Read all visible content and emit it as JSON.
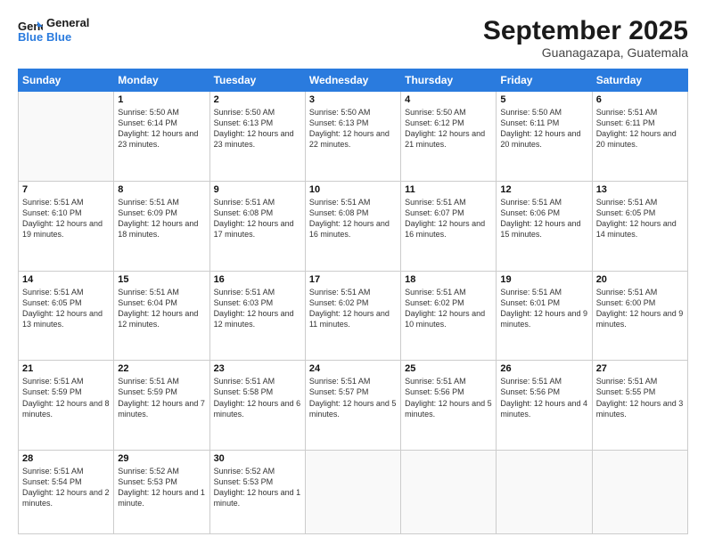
{
  "header": {
    "logo_line1": "General",
    "logo_line2": "Blue",
    "month": "September 2025",
    "location": "Guanagazapa, Guatemala"
  },
  "weekdays": [
    "Sunday",
    "Monday",
    "Tuesday",
    "Wednesday",
    "Thursday",
    "Friday",
    "Saturday"
  ],
  "weeks": [
    [
      {
        "day": "",
        "info": ""
      },
      {
        "day": "1",
        "info": "Sunrise: 5:50 AM\nSunset: 6:14 PM\nDaylight: 12 hours\nand 23 minutes."
      },
      {
        "day": "2",
        "info": "Sunrise: 5:50 AM\nSunset: 6:13 PM\nDaylight: 12 hours\nand 23 minutes."
      },
      {
        "day": "3",
        "info": "Sunrise: 5:50 AM\nSunset: 6:13 PM\nDaylight: 12 hours\nand 22 minutes."
      },
      {
        "day": "4",
        "info": "Sunrise: 5:50 AM\nSunset: 6:12 PM\nDaylight: 12 hours\nand 21 minutes."
      },
      {
        "day": "5",
        "info": "Sunrise: 5:50 AM\nSunset: 6:11 PM\nDaylight: 12 hours\nand 20 minutes."
      },
      {
        "day": "6",
        "info": "Sunrise: 5:51 AM\nSunset: 6:11 PM\nDaylight: 12 hours\nand 20 minutes."
      }
    ],
    [
      {
        "day": "7",
        "info": "Sunrise: 5:51 AM\nSunset: 6:10 PM\nDaylight: 12 hours\nand 19 minutes."
      },
      {
        "day": "8",
        "info": "Sunrise: 5:51 AM\nSunset: 6:09 PM\nDaylight: 12 hours\nand 18 minutes."
      },
      {
        "day": "9",
        "info": "Sunrise: 5:51 AM\nSunset: 6:08 PM\nDaylight: 12 hours\nand 17 minutes."
      },
      {
        "day": "10",
        "info": "Sunrise: 5:51 AM\nSunset: 6:08 PM\nDaylight: 12 hours\nand 16 minutes."
      },
      {
        "day": "11",
        "info": "Sunrise: 5:51 AM\nSunset: 6:07 PM\nDaylight: 12 hours\nand 16 minutes."
      },
      {
        "day": "12",
        "info": "Sunrise: 5:51 AM\nSunset: 6:06 PM\nDaylight: 12 hours\nand 15 minutes."
      },
      {
        "day": "13",
        "info": "Sunrise: 5:51 AM\nSunset: 6:05 PM\nDaylight: 12 hours\nand 14 minutes."
      }
    ],
    [
      {
        "day": "14",
        "info": "Sunrise: 5:51 AM\nSunset: 6:05 PM\nDaylight: 12 hours\nand 13 minutes."
      },
      {
        "day": "15",
        "info": "Sunrise: 5:51 AM\nSunset: 6:04 PM\nDaylight: 12 hours\nand 12 minutes."
      },
      {
        "day": "16",
        "info": "Sunrise: 5:51 AM\nSunset: 6:03 PM\nDaylight: 12 hours\nand 12 minutes."
      },
      {
        "day": "17",
        "info": "Sunrise: 5:51 AM\nSunset: 6:02 PM\nDaylight: 12 hours\nand 11 minutes."
      },
      {
        "day": "18",
        "info": "Sunrise: 5:51 AM\nSunset: 6:02 PM\nDaylight: 12 hours\nand 10 minutes."
      },
      {
        "day": "19",
        "info": "Sunrise: 5:51 AM\nSunset: 6:01 PM\nDaylight: 12 hours\nand 9 minutes."
      },
      {
        "day": "20",
        "info": "Sunrise: 5:51 AM\nSunset: 6:00 PM\nDaylight: 12 hours\nand 9 minutes."
      }
    ],
    [
      {
        "day": "21",
        "info": "Sunrise: 5:51 AM\nSunset: 5:59 PM\nDaylight: 12 hours\nand 8 minutes."
      },
      {
        "day": "22",
        "info": "Sunrise: 5:51 AM\nSunset: 5:59 PM\nDaylight: 12 hours\nand 7 minutes."
      },
      {
        "day": "23",
        "info": "Sunrise: 5:51 AM\nSunset: 5:58 PM\nDaylight: 12 hours\nand 6 minutes."
      },
      {
        "day": "24",
        "info": "Sunrise: 5:51 AM\nSunset: 5:57 PM\nDaylight: 12 hours\nand 5 minutes."
      },
      {
        "day": "25",
        "info": "Sunrise: 5:51 AM\nSunset: 5:56 PM\nDaylight: 12 hours\nand 5 minutes."
      },
      {
        "day": "26",
        "info": "Sunrise: 5:51 AM\nSunset: 5:56 PM\nDaylight: 12 hours\nand 4 minutes."
      },
      {
        "day": "27",
        "info": "Sunrise: 5:51 AM\nSunset: 5:55 PM\nDaylight: 12 hours\nand 3 minutes."
      }
    ],
    [
      {
        "day": "28",
        "info": "Sunrise: 5:51 AM\nSunset: 5:54 PM\nDaylight: 12 hours\nand 2 minutes."
      },
      {
        "day": "29",
        "info": "Sunrise: 5:52 AM\nSunset: 5:53 PM\nDaylight: 12 hours\nand 1 minute."
      },
      {
        "day": "30",
        "info": "Sunrise: 5:52 AM\nSunset: 5:53 PM\nDaylight: 12 hours\nand 1 minute."
      },
      {
        "day": "",
        "info": ""
      },
      {
        "day": "",
        "info": ""
      },
      {
        "day": "",
        "info": ""
      },
      {
        "day": "",
        "info": ""
      }
    ]
  ]
}
